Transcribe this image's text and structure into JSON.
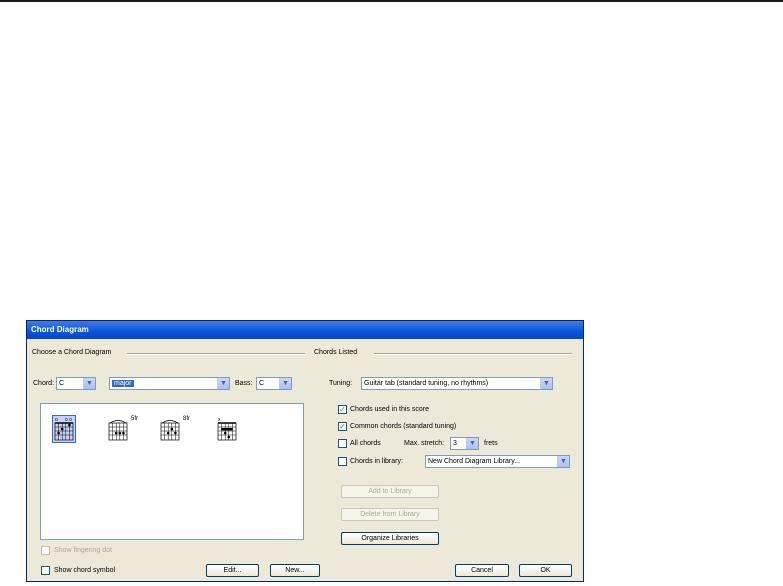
{
  "dialog": {
    "title": "Chord Diagram",
    "left_group": {
      "label": "Choose a Chord Diagram",
      "chord_label": "Chord:",
      "chord_value": "C",
      "quality_value": "major",
      "bass_label": "Bass:",
      "bass_value": "C",
      "chords": [
        {
          "suffix": ""
        },
        {
          "suffix": "5fr"
        },
        {
          "suffix": "8fr"
        },
        {
          "suffix": ""
        }
      ],
      "show_fingering_label": "Show fingering dot",
      "show_chord_symbol_label": "Show chord symbol",
      "edit_button": "Edit...",
      "new_button": "New..."
    },
    "right_group": {
      "label": "Chords Listed",
      "tuning_label": "Tuning:",
      "tuning_value": "Guitar tab (standard tuning, no rhythms)",
      "used_in_score_label": "Chords used in this score",
      "used_in_score_checked": true,
      "common_chords_label": "Common chords (standard tuning)",
      "common_chords_checked": true,
      "all_chords_label": "All chords",
      "all_chords_checked": false,
      "max_stretch_label": "Max. stretch:",
      "max_stretch_value": "3",
      "frets_label": "frets",
      "in_library_label": "Chords in library:",
      "in_library_checked": false,
      "library_value": "New Chord Diagram Library...",
      "add_to_library_button": "Add to Library",
      "delete_from_library_button": "Delete from Library",
      "organize_button": "Organize Libraries"
    },
    "cancel_button": "Cancel",
    "ok_button": "OK"
  },
  "colors": {
    "title_bar": "#0a55d8",
    "dialog_bg": "#ece9d8",
    "selection": "#316ac5",
    "check": "#21a121"
  }
}
